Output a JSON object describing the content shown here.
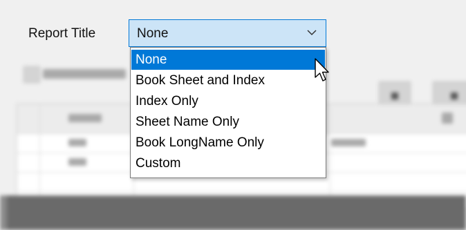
{
  "report_title": {
    "label": "Report Title",
    "selected_value": "None",
    "options": [
      "None",
      "Book Sheet and Index",
      "Index Only",
      "Sheet Name Only",
      "Book LongName Only",
      "Custom"
    ],
    "highlighted_option": "None"
  },
  "colors": {
    "accent": "#0078d7",
    "combo_background": "#cce4f7",
    "highlight_text": "#ffffff"
  },
  "icons": {
    "dropdown": "chevron-down-icon",
    "pointer": "mouse-pointer-icon"
  }
}
